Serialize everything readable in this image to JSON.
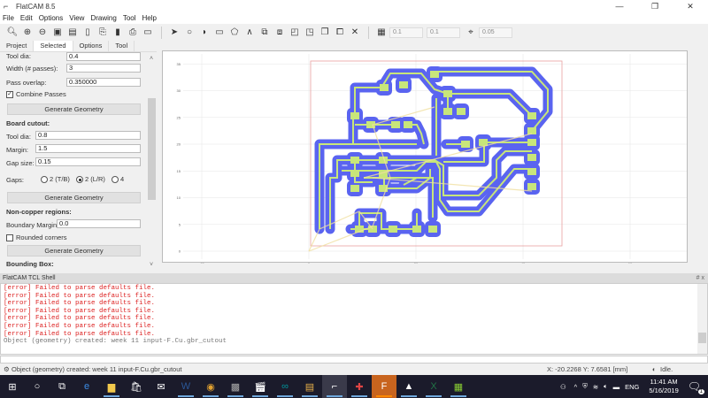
{
  "window": {
    "title": "FlatCAM 8.5",
    "controls": [
      "—",
      "❐",
      "✕"
    ]
  },
  "menu": [
    "File",
    "Edit",
    "Options",
    "View",
    "Drawing",
    "Tool",
    "Help"
  ],
  "toolbar": {
    "icons": [
      "zoom-fit-icon",
      "zoom-in-icon",
      "zoom-out-icon",
      "replot-icon",
      "clear-plot-icon",
      "new-project-icon",
      "open-icon",
      "open-gerber-icon",
      "save-icon",
      "shell-icon",
      "select-icon",
      "circle-icon",
      "arc-icon",
      "rectangle-icon",
      "polygon-icon",
      "path-icon",
      "union-icon",
      "intersection-icon",
      "subtract-icon",
      "cut-icon",
      "copy-icon",
      "move-icon",
      "delete-icon"
    ],
    "grid_x": "0.1",
    "grid_y": "0.1",
    "snap": "0.05"
  },
  "tabs": [
    "Project",
    "Selected",
    "Options",
    "Tool"
  ],
  "active_tab": "Selected",
  "panel": {
    "tool_dia_label": "Tool dia:",
    "tool_dia": "0.4",
    "width_label": "Width (# passes):",
    "width": "3",
    "overlap_label": "Pass overlap:",
    "overlap": "0.350000",
    "combine_label": "Combine Passes",
    "combine_checked": true,
    "generate": "Generate Geometry",
    "board_cutout": "Board cutout:",
    "cut_tool_dia_label": "Tool dia:",
    "cut_tool_dia": "0.8",
    "margin_label": "Margin:",
    "margin": "1.5",
    "gap_size_label": "Gap size:",
    "gap_size": "0.15",
    "gaps_label": "Gaps:",
    "gaps_options": [
      "2 (T/B)",
      "2 (L/R)",
      "4"
    ],
    "gaps_selected": "2 (L/R)",
    "non_copper": "Non-copper regions:",
    "boundary_label": "Boundary Margin:",
    "boundary": "0.0",
    "rounded_label": "Rounded corners",
    "rounded_checked": false,
    "bounding_box": "Bounding Box:"
  },
  "plot": {
    "x_ticks": [
      "-20",
      "0",
      "20",
      "40",
      "60"
    ],
    "y_ticks": [
      "0",
      "5",
      "10",
      "15",
      "20",
      "25",
      "30",
      "35"
    ],
    "colors": {
      "copper_fill": "#c8e67a",
      "isolation": "#5a64f0",
      "outline": "#e8a0a0",
      "rats": "#f0e0a0"
    }
  },
  "shell": {
    "title": "FlatCAM TCL Shell",
    "controls": "# x",
    "lines": [
      {
        "type": "err",
        "text": "[error] Failed to parse defaults file."
      },
      {
        "type": "err",
        "text": "[error] Failed to parse defaults file."
      },
      {
        "type": "err",
        "text": "[error] Failed to parse defaults file."
      },
      {
        "type": "err",
        "text": "[error] Failed to parse defaults file."
      },
      {
        "type": "err",
        "text": "[error] Failed to parse defaults file."
      },
      {
        "type": "err",
        "text": "[error] Failed to parse defaults file."
      },
      {
        "type": "err",
        "text": "[error] Failed to parse defaults file."
      },
      {
        "type": "ok",
        "text": "Object (geometry) created: week 11 input-F.Cu.gbr_cutout"
      }
    ]
  },
  "status": {
    "message": "Object (geometry) created: week 11 input-F.Cu.gbr_cutout",
    "coords": "X: -20.2268   Y: 7.6581  [mm]",
    "state": "Idle."
  },
  "taskbar": {
    "apps": [
      "windows-start-icon",
      "cortana-icon",
      "task-view-icon",
      "edge-icon",
      "file-explorer-icon",
      "store-icon",
      "mail-icon",
      "word-icon",
      "chrome-icon",
      "photo-app-icon",
      "video-editor-icon",
      "arduino-icon",
      "document-app-icon",
      "flatcam-icon",
      "kicad-pcb-icon",
      "fusion-icon",
      "photos-icon",
      "excel-icon",
      "pcb-app-icon"
    ],
    "time": "11:41 AM",
    "date": "5/16/2019",
    "lang": "ENG",
    "notification_count": "1"
  }
}
